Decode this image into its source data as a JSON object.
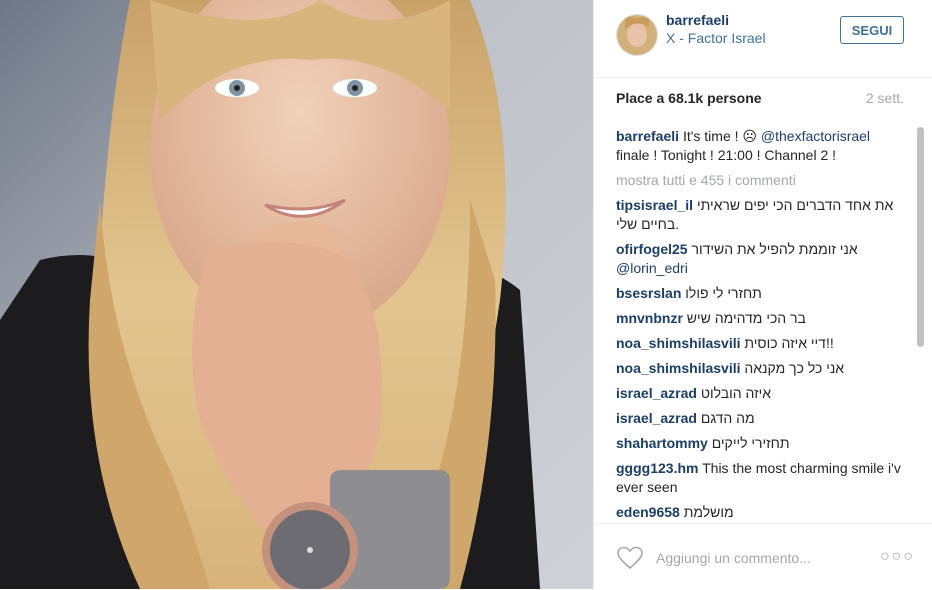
{
  "post": {
    "username": "barrefaeli",
    "location": "X - Factor Israel",
    "follow_label": "SEGUI",
    "likes_text": "Place a 68.1k persone",
    "age": "2 sett."
  },
  "caption": {
    "user": "barrefaeli",
    "text_before": "It's time ! ☹ ",
    "mention": "@thexfactorisrael",
    "text_after": " finale ! Tonight ! 21:00 ! Channel 2 !"
  },
  "show_all_comments": "mostra tutti e 455 i commenti",
  "comments": [
    {
      "user": "tipsisrael_il",
      "text": "את אחד הדברים הכי יפים שראיתי בחיים שלי."
    },
    {
      "user": "ofirfogel25",
      "text": "אני זוממת להפיל את השידור",
      "mention": "@lorin_edri"
    },
    {
      "user": "bsesrslan",
      "text": "תחזרי לי פולו"
    },
    {
      "user": "mnvnbnzr",
      "text": "בר הכי מדהימה שיש"
    },
    {
      "user": "noa_shimshilasvili",
      "text": "דיי איזה כוסית!!"
    },
    {
      "user": "noa_shimshilasvili",
      "text": "אני כל כך מקנאה"
    },
    {
      "user": "israel_azrad",
      "text": "איזה הובלוט"
    },
    {
      "user": "israel_azrad",
      "text": "מה הדגם"
    },
    {
      "user": "shahartommy",
      "text": "תחזירי לייקים"
    },
    {
      "user": "gggg123.hm",
      "text": "This the most charming smile i'v ever seen"
    },
    {
      "user": "eden9658",
      "text": "מושלמת"
    }
  ],
  "footer": {
    "add_comment_placeholder": "Aggiungi un commento...",
    "more_options": "○○○"
  },
  "colors": {
    "username_blue": "#1b3e6b",
    "link_blue": "#3f729b",
    "muted_gray": "#a5a7aa"
  },
  "icons": {
    "like": "heart-outline-icon",
    "more": "more-options-icon"
  }
}
